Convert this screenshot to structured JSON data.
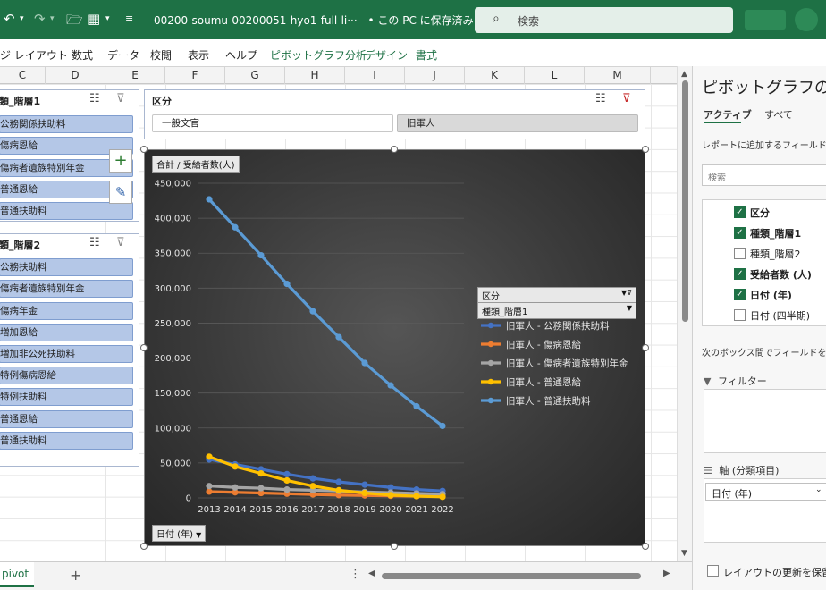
{
  "titlebar": {
    "file_name": "00200-soumu-00200051-hyo1-full-li···",
    "save_status": "• この PC に保存済み ∨",
    "search_placeholder": "検索"
  },
  "menu": {
    "items": [
      "ジ レイアウト",
      "数式",
      "データ",
      "校閲",
      "表示",
      "ヘルプ"
    ],
    "context_items": [
      "ピボットグラフ分析",
      "デザイン",
      "書式"
    ]
  },
  "columns": [
    "C",
    "D",
    "E",
    "F",
    "G",
    "H",
    "I",
    "J",
    "K",
    "L",
    "M"
  ],
  "slicer1": {
    "title": "類_階層1",
    "items": [
      "公務関係扶助料",
      "傷病恩給",
      "傷病者遺族特別年金",
      "普通恩給",
      "普通扶助料"
    ]
  },
  "slicer2": {
    "title": "類_階層2",
    "items": [
      "公務扶助料",
      "傷病者遺族特別年金",
      "傷病年金",
      "増加恩給",
      "増加非公死扶助料",
      "特例傷病恩給",
      "特例扶助料",
      "普通恩給",
      "普通扶助料"
    ]
  },
  "slicer3": {
    "title": "区分",
    "items": [
      "一般文官",
      "旧軍人"
    ]
  },
  "chart_data": {
    "type": "line",
    "value_field_button": "合計 / 受給者数(人)",
    "axis_field_button": "日付 (年)",
    "legend_field_button_1": "区分",
    "legend_field_button_2": "種類_階層1",
    "x": [
      2013,
      2014,
      2015,
      2016,
      2017,
      2018,
      2019,
      2020,
      2021,
      2022
    ],
    "ylim": [
      0,
      450000
    ],
    "yticks": [
      0,
      50000,
      100000,
      150000,
      200000,
      250000,
      300000,
      350000,
      400000,
      450000
    ],
    "ytick_labels": [
      "0",
      "50,000",
      "100,000",
      "150,000",
      "200,000",
      "250,000",
      "300,000",
      "350,000",
      "400,000",
      "450,000"
    ],
    "series": [
      {
        "name": "旧軍人 - 公務関係扶助料",
        "color": "#4472c4",
        "values": [
          55000,
          48000,
          41000,
          34000,
          28000,
          23000,
          19000,
          15000,
          12000,
          10000
        ]
      },
      {
        "name": "旧軍人 - 傷病恩給",
        "color": "#ed7d31",
        "values": [
          9000,
          8000,
          7000,
          6000,
          5000,
          4000,
          3500,
          3000,
          2500,
          2000
        ]
      },
      {
        "name": "旧軍人 - 傷病者遺族特別年金",
        "color": "#a5a5a5",
        "values": [
          17000,
          15000,
          14000,
          12000,
          11000,
          10000,
          8500,
          7500,
          6500,
          5500
        ]
      },
      {
        "name": "旧軍人 - 普通恩給",
        "color": "#ffc000",
        "values": [
          59000,
          45000,
          35000,
          25000,
          17000,
          11000,
          7000,
          4000,
          2500,
          1500
        ]
      },
      {
        "name": "旧軍人 - 普通扶助料",
        "color": "#5b9bd5",
        "values": [
          427000,
          387000,
          347000,
          306000,
          267000,
          230000,
          193000,
          161000,
          131000,
          103000
        ]
      }
    ]
  },
  "sheet": {
    "tab_name": "pivot"
  },
  "pane": {
    "title": "ピボットグラフのフィ",
    "tab_active": "アクティブ",
    "tab_all": "すべて",
    "hint": "レポートに追加するフィールドを選",
    "search_placeholder": "検索",
    "fields": [
      {
        "label": "区分",
        "checked": true
      },
      {
        "label": "種類_階層1",
        "checked": true
      },
      {
        "label": "種類_階層2",
        "checked": false
      },
      {
        "label": "受給者数 (人)",
        "checked": true
      },
      {
        "label": "日付 (年)",
        "checked": true
      },
      {
        "label": "日付 (四半期)",
        "checked": false
      }
    ],
    "drag_note": "次のボックス間でフィールドをドラ",
    "filter_label": "フィルター",
    "axis_label": "軸 (分類項目)",
    "axis_item": "日付 (年)",
    "defer_label": "レイアウトの更新を保留す"
  }
}
